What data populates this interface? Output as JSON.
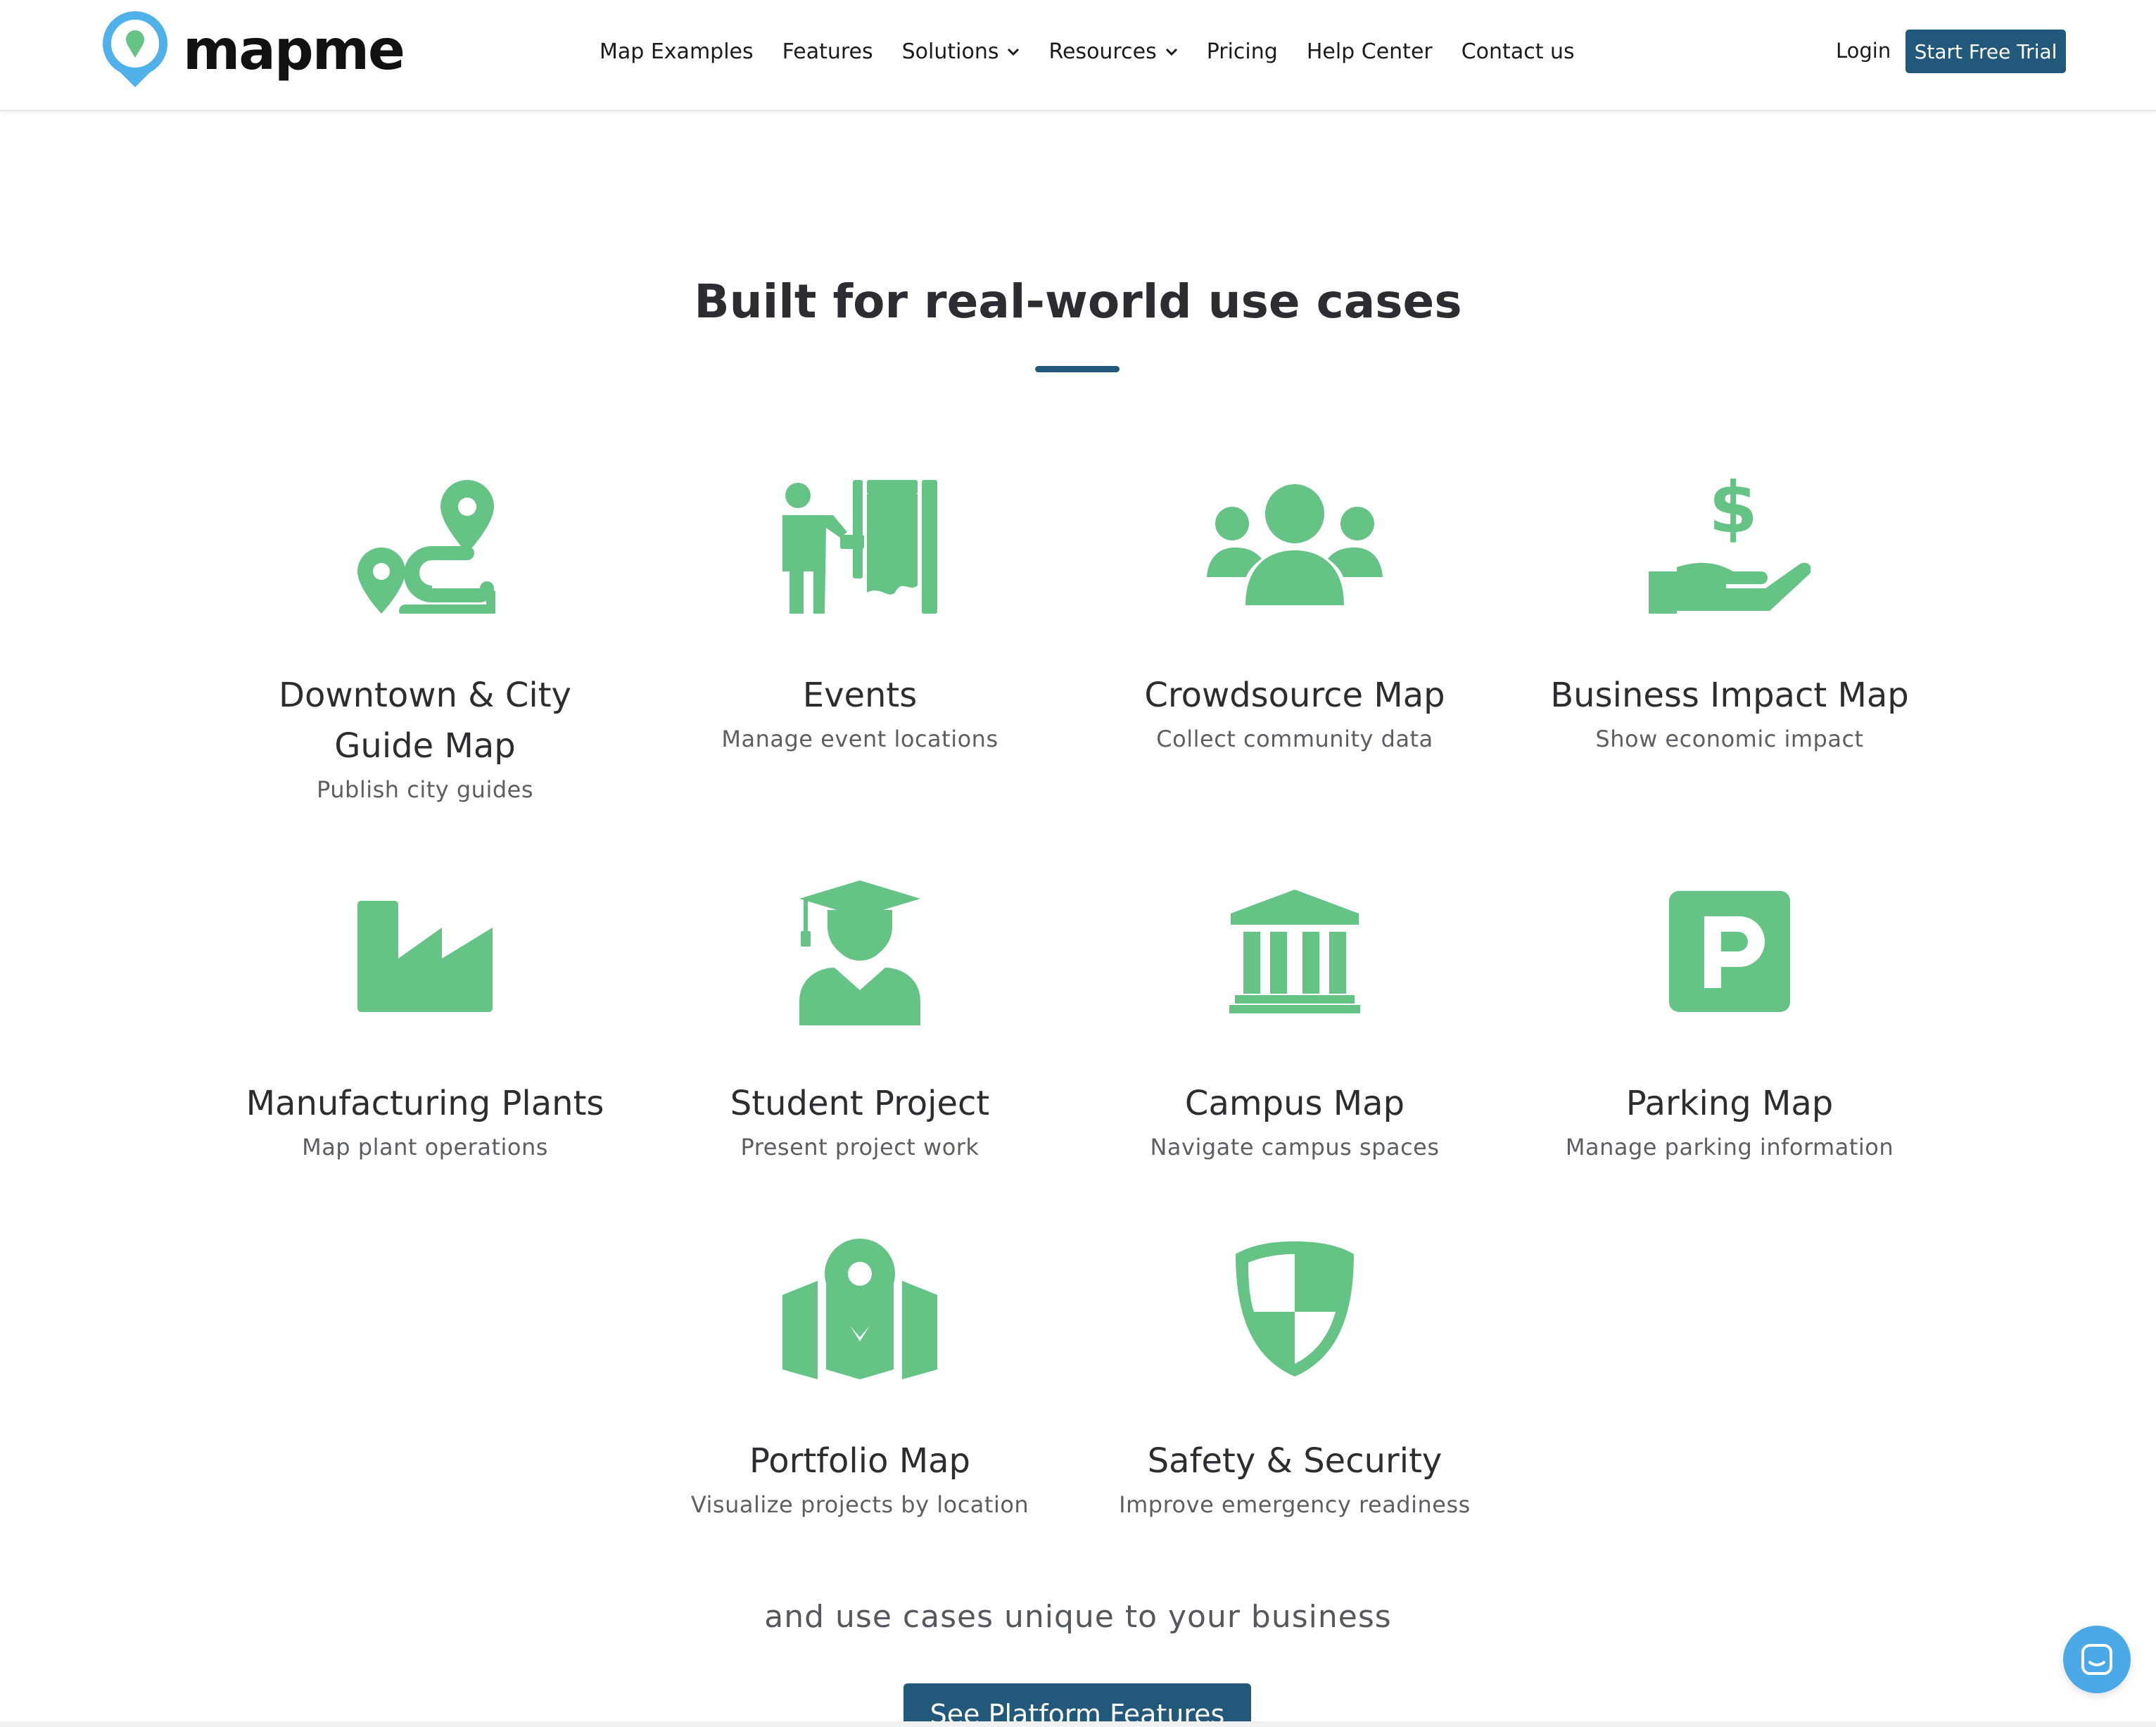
{
  "brand": {
    "name": "mapme",
    "accent": "#225879",
    "icon_green": "#66c386",
    "logo_blue": "#4fb0ea"
  },
  "nav": {
    "items": [
      {
        "label": "Map Examples",
        "has_dropdown": false
      },
      {
        "label": "Features",
        "has_dropdown": false
      },
      {
        "label": "Solutions",
        "has_dropdown": true
      },
      {
        "label": "Resources",
        "has_dropdown": true
      },
      {
        "label": "Pricing",
        "has_dropdown": false
      },
      {
        "label": "Help Center",
        "has_dropdown": false
      },
      {
        "label": "Contact us",
        "has_dropdown": false
      }
    ],
    "login": "Login",
    "cta": "Start Free Trial"
  },
  "section": {
    "title": "Built for real-world use cases",
    "tagline": "and use cases unique to your business",
    "button": "See Platform Features"
  },
  "cards": [
    {
      "icon": "route-pin-icon",
      "title_lines": [
        "Downtown & City",
        "Guide Map"
      ],
      "desc": "Publish city guides"
    },
    {
      "icon": "event-curtain-icon",
      "title_lines": [
        "Events"
      ],
      "desc": "Manage event locations"
    },
    {
      "icon": "users-group-icon",
      "title_lines": [
        "Crowdsource Map"
      ],
      "desc": "Collect community data"
    },
    {
      "icon": "hand-dollar-icon",
      "title_lines": [
        "Business Impact Map"
      ],
      "desc": "Show economic impact"
    },
    {
      "icon": "factory-icon",
      "title_lines": [
        "Manufacturing Plants"
      ],
      "desc": "Map plant operations"
    },
    {
      "icon": "graduate-icon",
      "title_lines": [
        "Student Project"
      ],
      "desc": "Present project work"
    },
    {
      "icon": "campus-building-icon",
      "title_lines": [
        "Campus Map"
      ],
      "desc": "Navigate campus spaces"
    },
    {
      "icon": "parking-icon",
      "title_lines": [
        "Parking Map"
      ],
      "desc": "Manage parking information"
    },
    {
      "icon": "folded-map-pin-icon",
      "title_lines": [
        "Portfolio Map"
      ],
      "desc": "Visualize projects by location"
    },
    {
      "icon": "shield-icon",
      "title_lines": [
        "Safety & Security"
      ],
      "desc": "Improve emergency readiness"
    }
  ],
  "chat": {
    "icon": "chat-icon"
  }
}
